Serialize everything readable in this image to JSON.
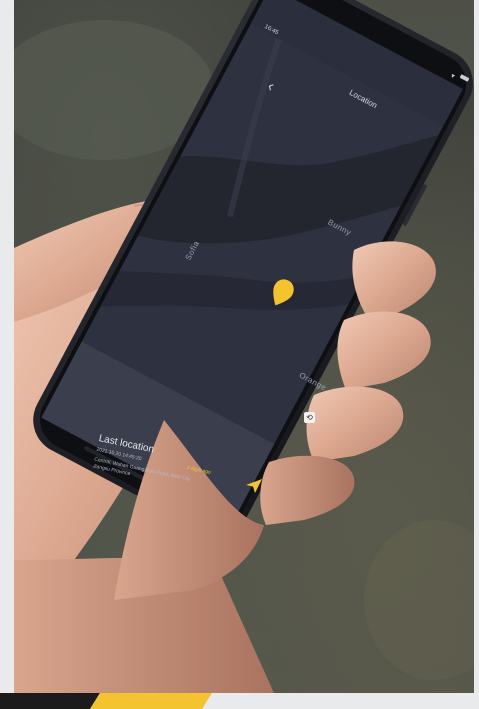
{
  "status_bar": {
    "time": "16:45"
  },
  "header": {
    "title": "Location"
  },
  "map": {
    "labels": [
      "Sofia",
      "Bunny",
      "Orange"
    ]
  },
  "location_card": {
    "title": "Last location",
    "datetime": "2021.10.20  14:45:20",
    "time_ago": "3 days ago",
    "address_line1": "Central, Wuhan Guangzhou Road, Wan City",
    "address_line2": "Jiangsu Province"
  },
  "colors": {
    "accent": "#f4c430",
    "screen_background": "#2e3140",
    "map_land": "#3a3e50",
    "map_river": "#2a2c39"
  },
  "icons": {
    "back": "chevron-left-icon",
    "pin": "location-pin-icon",
    "navigate": "navigation-arrow-icon",
    "wifi": "wifi-icon",
    "battery": "battery-icon"
  }
}
